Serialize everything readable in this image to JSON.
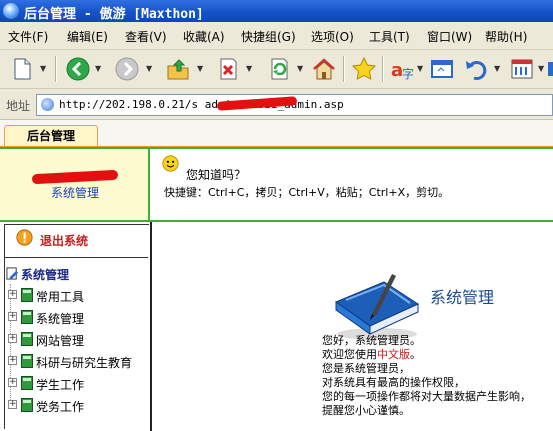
{
  "window": {
    "title": "后台管理 - 傲游 [Maxthon]"
  },
  "menu": {
    "items": [
      "文件(F)",
      "编辑(E)",
      "查看(V)",
      "收藏(A)",
      "快捷组(G)",
      "选项(O)",
      "工具(T)",
      "窗口(W)",
      "帮助(H)"
    ]
  },
  "address": {
    "label": "地址",
    "url": "http://202.198.0.21/s            admin/baozi_admin.asp"
  },
  "tabs": [
    {
      "label": "后台管理",
      "active": true
    }
  ],
  "header": {
    "logo_text": "系统管理",
    "tip_title": "您知道吗？",
    "tip_text": "快捷键：Ctrl+C，拷贝；Ctrl+V，粘贴；Ctrl+X，剪切。"
  },
  "sidebar": {
    "logout_label": "退出系统",
    "root_label": "系统管理",
    "items": [
      {
        "label": "常用工具"
      },
      {
        "label": "系统管理"
      },
      {
        "label": "网站管理"
      },
      {
        "label": "科研与研究生教育"
      },
      {
        "label": "学生工作"
      },
      {
        "label": "党务工作"
      }
    ]
  },
  "main": {
    "title": "系统管理",
    "line1": "您好，系统管理员。",
    "line2_prefix": "欢迎您使用",
    "line2_highlight": "中文版",
    "line2_suffix": "。",
    "line3": "您是系统管理员，",
    "line4": "对系统具有最高的操作权限，",
    "line5": "您的每一项操作都将对大量数据产生影响，",
    "line6": "提醒您小心谨慎。"
  },
  "colors": {
    "accent_green": "#3bb23b",
    "tab_orange": "#f09422",
    "highlight_red": "#d01818",
    "logout_red": "#c81d1d"
  }
}
